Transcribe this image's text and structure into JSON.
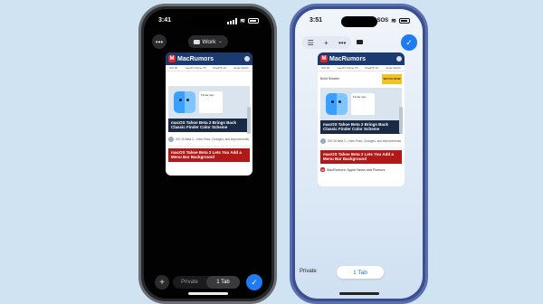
{
  "left_phone": {
    "status_time": "3:41",
    "tab_group_label": "Work",
    "bottom_bar": {
      "private_label": "Private",
      "tabs_label": "1 Tab"
    }
  },
  "right_phone": {
    "status_time": "3:51",
    "status_sos": "SOS",
    "bottom_bar": {
      "private_label": "Private",
      "tabs_label": "1 Tab"
    },
    "page_footer": "MacRumors: Apple News and Rumors"
  },
  "tab_card": {
    "site_name": "MacRumors",
    "nav_items": [
      "iOS 26",
      "macOS Tahoe 26",
      "iPadOS 26",
      "Apple Watch"
    ],
    "ad_title": "Build Smarter",
    "ad_badge": "WATCH NOW",
    "hero_window_label": "Finder app",
    "headline": "macOS Tahoe Beta 2 Brings Back Classic Finder Color Scheme",
    "subheadline": "iOS 26 Beta 2 – New Fixes, Changes, and Improvements",
    "red_headline": "macOS Tahoe Beta 2 Lets You Add a Menu Bar Background"
  },
  "icons": {
    "more": "more-dots-icon",
    "plus": "plus-icon",
    "check": "checkmark-icon",
    "sidebar": "sidebar-list-icon",
    "monitor": "monitor-icon"
  },
  "colors": {
    "accent": "#1f7bf2",
    "brand_header": "#1b3b70",
    "brand_red": "#e0242b",
    "red_headline": "#b21818"
  }
}
